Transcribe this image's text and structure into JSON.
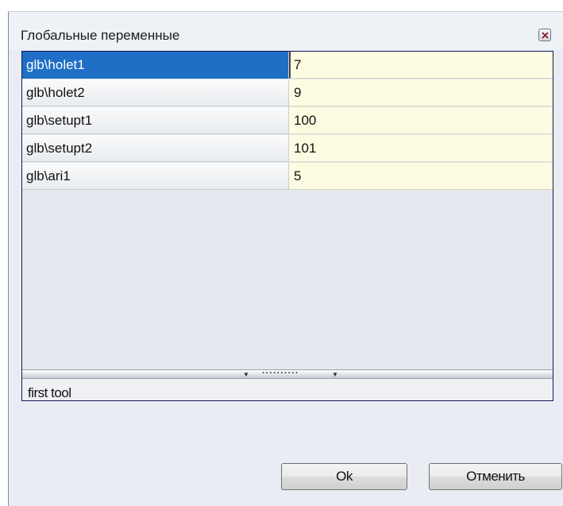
{
  "window": {
    "title": "Глобальные переменные"
  },
  "variables": [
    {
      "name": "glb\\holet1",
      "value": "7",
      "selected": true
    },
    {
      "name": "glb\\holet2",
      "value": "9",
      "selected": false
    },
    {
      "name": "glb\\setupt1",
      "value": "100",
      "selected": false
    },
    {
      "name": "glb\\setupt2",
      "value": "101",
      "selected": false
    },
    {
      "name": "glb\\ari1",
      "value": "5",
      "selected": false
    }
  ],
  "description": {
    "text": "first tool"
  },
  "buttons": {
    "ok_label": "Ok",
    "cancel_label": "Отменить"
  },
  "colors": {
    "selection": "#1e6fc5",
    "value_cell": "#fdfbe1",
    "grid_border": "#101a55",
    "dialog_bg": "#e9edf3"
  }
}
